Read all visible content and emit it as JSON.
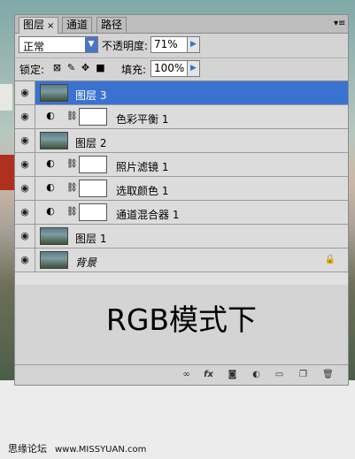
{
  "tabs": [
    {
      "label": "图层",
      "close": "×"
    },
    {
      "label": "通道"
    },
    {
      "label": "路径"
    }
  ],
  "panel_menu_icon": "panel-menu-icon",
  "blend_mode": "正常",
  "opacity": {
    "label": "不透明度:",
    "value": "71%"
  },
  "lock": {
    "label": "锁定:"
  },
  "fill": {
    "label": "填充:",
    "value": "100%"
  },
  "layers": [
    {
      "name": "图层 3",
      "type": "image",
      "selected": true
    },
    {
      "name": "色彩平衡 1",
      "type": "adjustment"
    },
    {
      "name": "图层 2",
      "type": "image"
    },
    {
      "name": "照片滤镜 1",
      "type": "adjustment"
    },
    {
      "name": "选取颜色 1",
      "type": "adjustment"
    },
    {
      "name": "通道混合器 1",
      "type": "adjustment"
    },
    {
      "name": "图层 1",
      "type": "image"
    },
    {
      "name": "背景",
      "type": "background",
      "locked": true
    }
  ],
  "caption": "RGB模式下",
  "footer_icons": [
    "link-icon",
    "fx-icon",
    "mask-icon",
    "adjustment-icon",
    "group-icon",
    "new-layer-icon",
    "trash-icon"
  ],
  "credit": {
    "site": "思缘论坛",
    "url": "www.MISSYUAN.com"
  },
  "colors": {
    "selection": "#3a72d2",
    "panel": "#d4d4d4"
  }
}
